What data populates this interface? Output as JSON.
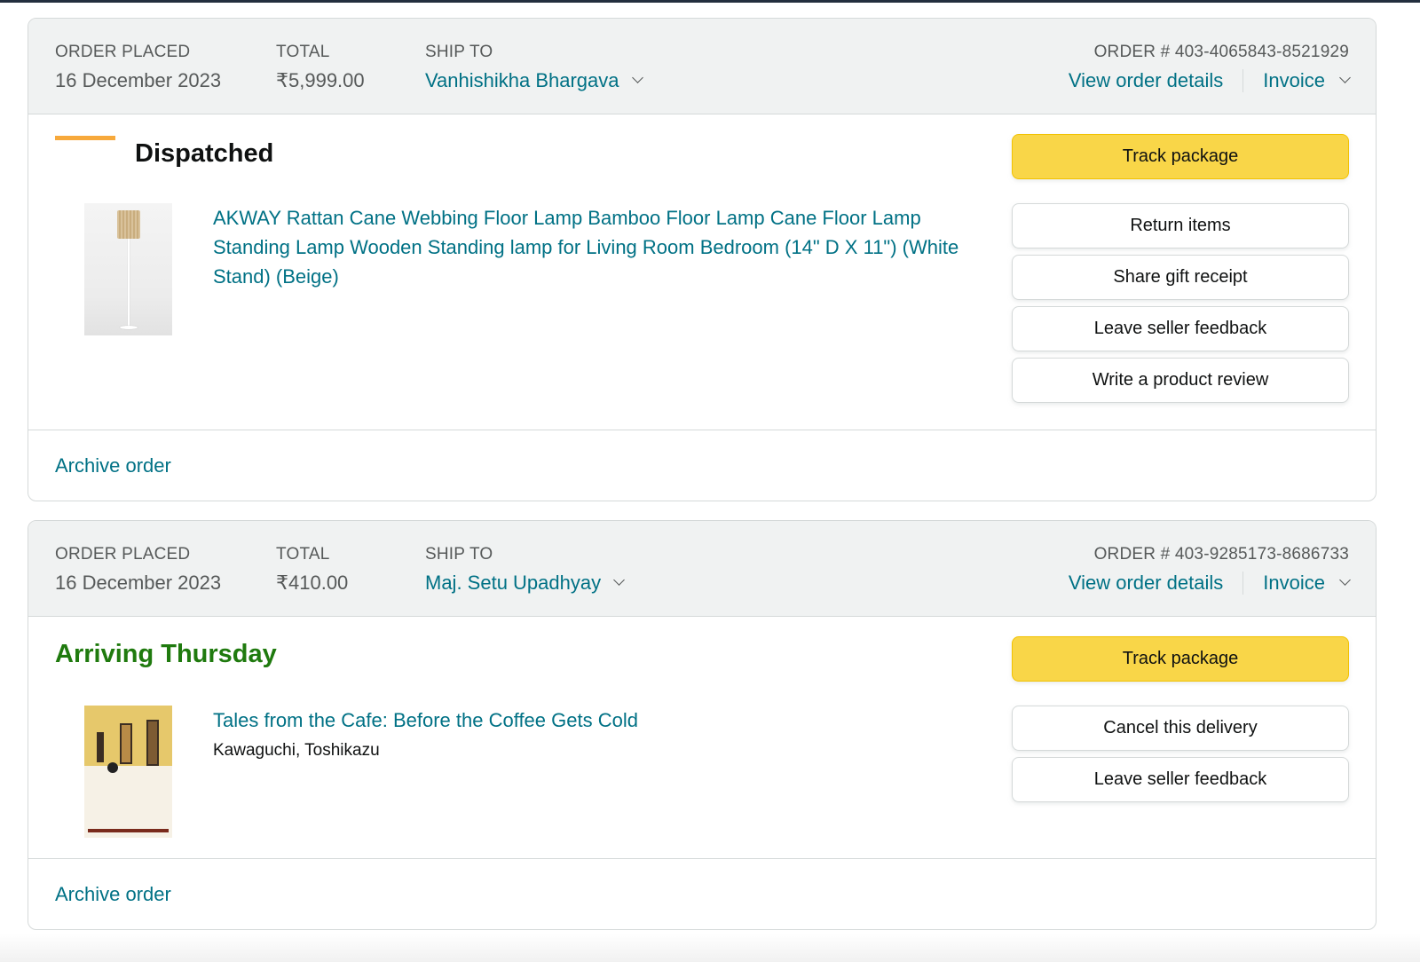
{
  "orders": [
    {
      "placed_label": "ORDER PLACED",
      "placed_date": "16 December 2023",
      "total_label": "TOTAL",
      "total": "₹5,999.00",
      "ship_to_label": "SHIP TO",
      "ship_to": "Vanhishikha Bhargava",
      "order_number": "ORDER # 403-4065843-8521929",
      "view_details": "View order details",
      "invoice": "Invoice",
      "status": "Dispatched",
      "item": {
        "title": "AKWAY Rattan Cane Webbing Floor Lamp Bamboo Floor Lamp Cane Floor Lamp Standing Lamp Wooden Standing lamp for Living Room Bedroom (14\" D X 11\") (White Stand) (Beige)",
        "author": ""
      },
      "buttons": [
        "Track package",
        "Return items",
        "Share gift receipt",
        "Leave seller feedback",
        "Write a product review"
      ],
      "archive": "Archive order"
    },
    {
      "placed_label": "ORDER PLACED",
      "placed_date": "16 December 2023",
      "total_label": "TOTAL",
      "total": "₹410.00",
      "ship_to_label": "SHIP TO",
      "ship_to": "Maj. Setu Upadhyay",
      "order_number": "ORDER # 403-9285173-8686733",
      "view_details": "View order details",
      "invoice": "Invoice",
      "status": "Arriving Thursday",
      "item": {
        "title": "Tales from the Cafe: Before the Coffee Gets Cold",
        "author": "Kawaguchi, Toshikazu"
      },
      "buttons": [
        "Track package",
        "Cancel this delivery",
        "Leave seller feedback"
      ],
      "archive": "Archive order"
    }
  ],
  "colors": {
    "link": "#007185",
    "header_bg": "#f0f2f2",
    "primary_button": "#f9d648",
    "status_dispatched_bar": "#f7a93b",
    "status_arriving": "#1f7a0e"
  }
}
